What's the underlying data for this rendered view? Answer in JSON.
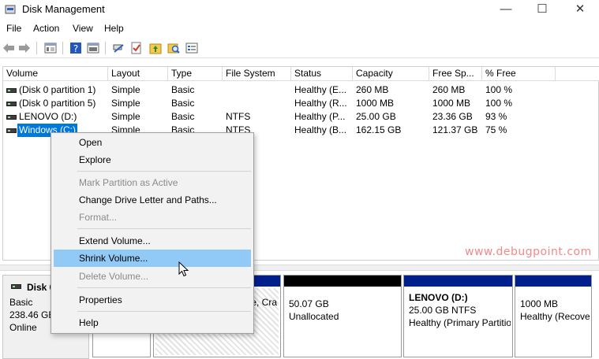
{
  "window": {
    "title": "Disk Management",
    "min_glyph": "—",
    "max_glyph": "☐",
    "close_glyph": "✕"
  },
  "menu": [
    "File",
    "Action",
    "View",
    "Help"
  ],
  "toolbar": {
    "buttons": [
      "back-arrow-icon",
      "forward-arrow-icon",
      "disk-list-icon",
      "help-icon",
      "view-icon",
      "connect-icon",
      "checklist-icon",
      "up-folder-icon",
      "search-folder-icon",
      "properties-icon"
    ]
  },
  "volume_list": {
    "columns": [
      "Volume",
      "Layout",
      "Type",
      "File System",
      "Status",
      "Capacity",
      "Free Sp...",
      "% Free"
    ],
    "rows": [
      {
        "volume": "(Disk 0 partition 1)",
        "layout": "Simple",
        "type": "Basic",
        "fs": "",
        "status": "Healthy (E...",
        "capacity": "260 MB",
        "free": "260 MB",
        "pct": "100 %"
      },
      {
        "volume": "(Disk 0 partition 5)",
        "layout": "Simple",
        "type": "Basic",
        "fs": "",
        "status": "Healthy (R...",
        "capacity": "1000 MB",
        "free": "1000 MB",
        "pct": "100 %"
      },
      {
        "volume": "LENOVO (D:)",
        "layout": "Simple",
        "type": "Basic",
        "fs": "NTFS",
        "status": "Healthy (P...",
        "capacity": "25.00 GB",
        "free": "23.36 GB",
        "pct": "93 %"
      },
      {
        "volume": "Windows (C:)",
        "layout": "Simple",
        "type": "Basic",
        "fs": "NTFS",
        "status": "Healthy (B...",
        "capacity": "162.15 GB",
        "free": "121.37 GB",
        "pct": "75 %"
      }
    ]
  },
  "context_menu": {
    "items": [
      {
        "label": "Open",
        "enabled": true
      },
      {
        "label": "Explore",
        "enabled": true
      },
      {
        "label": "Mark Partition as Active",
        "enabled": false
      },
      {
        "label": "Change Drive Letter and Paths...",
        "enabled": true
      },
      {
        "label": "Format...",
        "enabled": false
      },
      {
        "label": "Extend Volume...",
        "enabled": true
      },
      {
        "label": "Shrink Volume...",
        "enabled": true,
        "highlighted": true
      },
      {
        "label": "Delete Volume...",
        "enabled": false
      },
      {
        "label": "Properties",
        "enabled": true
      },
      {
        "label": "Help",
        "enabled": true
      }
    ]
  },
  "watermark": "www.debugpoint.com",
  "disk": {
    "name": "Disk 0",
    "type": "Basic",
    "size": "238.46 GB",
    "status": "Online",
    "partitions": [
      {
        "line1": "",
        "line2": ""
      },
      {
        "line1": "",
        "line2": "e, Cra"
      },
      {
        "line1": "50.07 GB",
        "line2": "Unallocated"
      },
      {
        "title": "LENOVO  (D:)",
        "line1": "25.00 GB NTFS",
        "line2": "Healthy (Primary Partitio"
      },
      {
        "line1": "1000 MB",
        "line2": "Healthy (Recove"
      }
    ]
  },
  "colors": {
    "selection": "#0078d7",
    "menu_hover": "#91c9f7",
    "partition_header": "#001f8c",
    "unallocated_header": "#000000"
  }
}
